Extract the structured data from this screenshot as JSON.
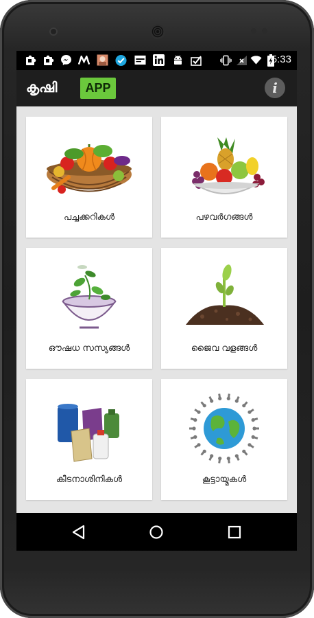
{
  "status_bar": {
    "notification_icons": [
      "puzzle-icon",
      "puzzle-icon",
      "messenger-icon",
      "m-logo-icon",
      "photo-icon",
      "check-badge-icon",
      "news-icon",
      "linkedin-icon",
      "android-icon",
      "check-box-icon"
    ],
    "system_icons": [
      "vibrate-icon",
      "signal-off-icon",
      "wifi-icon",
      "battery-charging-icon"
    ],
    "time": "5:33"
  },
  "app_bar": {
    "title": "കൃഷി",
    "badge": "APP",
    "badge_color": "#6bc83c",
    "info_icon": "info-icon"
  },
  "grid": {
    "items": [
      {
        "label": "പച്ചക്കറികൾ",
        "icon": "vegetable-basket-icon"
      },
      {
        "label": "പഴവർഗങ്ങൾ",
        "icon": "fruit-bowl-icon"
      },
      {
        "label": "ഔഷധ സസ്യങ്ങൾ",
        "icon": "herb-mortar-icon"
      },
      {
        "label": "ജൈവ വളങ്ങൾ",
        "icon": "seedling-soil-icon"
      },
      {
        "label": "കീടനാശിനികൾ",
        "icon": "pesticide-containers-icon"
      },
      {
        "label": "കൂട്ടായ്മകൾ",
        "icon": "globe-people-icon"
      }
    ]
  },
  "nav_bar": {
    "back_icon": "back-triangle-icon",
    "home_icon": "home-circle-icon",
    "recents_icon": "recents-square-icon"
  }
}
